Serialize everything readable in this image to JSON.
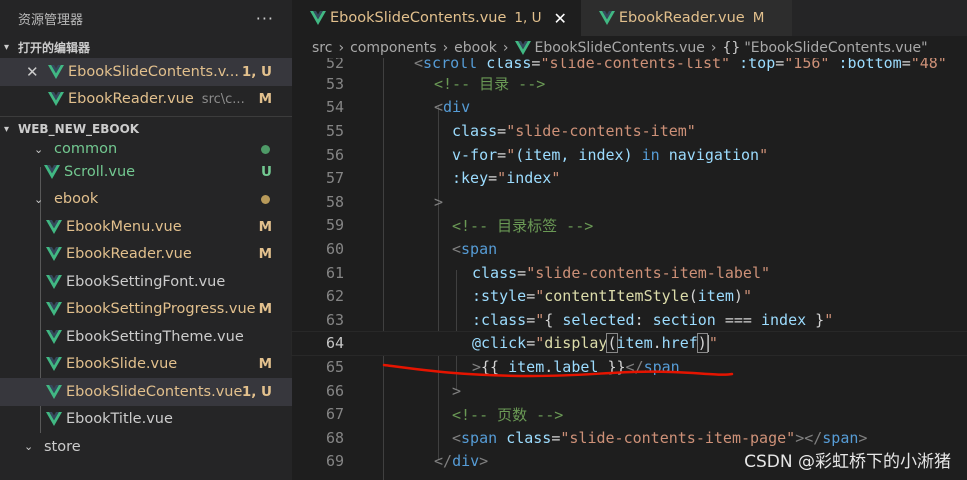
{
  "explorer": {
    "title": "资源管理器",
    "more_label": "···",
    "open_editors_header": "打开的编辑器",
    "open_editors": [
      {
        "name": "EbookSlideContents.v...",
        "status": "1, U",
        "close": "✕"
      },
      {
        "name": "EbookReader.vue",
        "path": "src\\c...",
        "status": "M"
      }
    ],
    "project_header": "WEB_NEW_EBOOK",
    "tree": [
      {
        "label": "common",
        "type": "folder"
      },
      {
        "label": "Scroll.vue",
        "status": "U"
      },
      {
        "label": "ebook",
        "type": "folder"
      },
      {
        "label": "EbookMenu.vue",
        "status": "M"
      },
      {
        "label": "EbookReader.vue",
        "status": "M"
      },
      {
        "label": "EbookSettingFont.vue",
        "status": ""
      },
      {
        "label": "EbookSettingProgress.vue",
        "status": "M"
      },
      {
        "label": "EbookSettingTheme.vue",
        "status": ""
      },
      {
        "label": "EbookSlide.vue",
        "status": "M"
      },
      {
        "label": "EbookSlideContents.vue",
        "status": "1, U"
      },
      {
        "label": "EbookTitle.vue",
        "status": ""
      },
      {
        "label": "store",
        "type": "folder"
      }
    ]
  },
  "tabs": [
    {
      "label": "EbookSlideContents.vue",
      "status": "1, U",
      "close": "✕"
    },
    {
      "label": "EbookReader.vue",
      "status": "M"
    }
  ],
  "breadcrumb": {
    "parts": [
      "src",
      "components",
      "ebook",
      "EbookSlideContents.vue"
    ],
    "braces": "{}",
    "symbol": "\"EbookSlideContents.vue\""
  },
  "code": {
    "current_line": "64",
    "lines": [
      {
        "n": "52",
        "text": "<scroll class=\"slide-contents-list\" :top=\"156\" :bottom=\"48\""
      },
      {
        "n": "53",
        "text": "<!-- 目录 -->"
      },
      {
        "n": "54",
        "text": "<div"
      },
      {
        "n": "55",
        "text": "class=\"slide-contents-item\""
      },
      {
        "n": "56",
        "text": "v-for=\"(item, index) in navigation\""
      },
      {
        "n": "57",
        "text": ":key=\"index\""
      },
      {
        "n": "58",
        "text": ">"
      },
      {
        "n": "59",
        "text": "<!-- 目录标签 -->"
      },
      {
        "n": "60",
        "text": "<span"
      },
      {
        "n": "61",
        "text": "class=\"slide-contents-item-label\""
      },
      {
        "n": "62",
        "text": ":style=\"contentItemStyle(item)\""
      },
      {
        "n": "63",
        "text": ":class=\"{ selected: section === index }\""
      },
      {
        "n": "64",
        "text": "@click=\"display(item.href)\""
      },
      {
        "n": "65",
        "text": ">{{ item.label }}</span"
      },
      {
        "n": "66",
        "text": ">"
      },
      {
        "n": "67",
        "text": "<!-- 页数 -->"
      },
      {
        "n": "68",
        "text": "<span class=\"slide-contents-item-page\"></span>"
      },
      {
        "n": "69",
        "text": "</div>"
      }
    ]
  },
  "watermark": "CSDN @彩虹桥下的小淅猪",
  "colors": {
    "modified": "#e2c08d",
    "untracked": "#73c991",
    "annotation": "#e51400"
  }
}
